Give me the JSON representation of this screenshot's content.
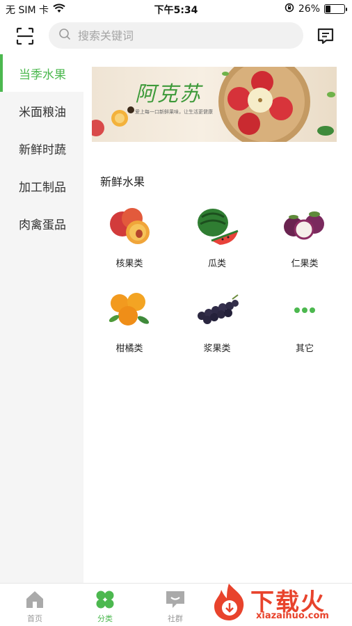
{
  "status_bar": {
    "carrier": "无 SIM 卡",
    "time": "下午5:34",
    "battery_percent": "26%",
    "battery_level": 0.26
  },
  "header": {
    "search_placeholder": "搜索关键词",
    "scan_icon": "scan-icon",
    "message_icon": "message-icon"
  },
  "sidebar": {
    "items": [
      {
        "label": "当季水果",
        "active": true
      },
      {
        "label": "米面粮油",
        "active": false
      },
      {
        "label": "新鲜时蔬",
        "active": false
      },
      {
        "label": "加工制品",
        "active": false
      },
      {
        "label": "肉禽蛋品",
        "active": false
      }
    ]
  },
  "banner": {
    "title": "阿克苏",
    "subtitle": "爱上每一口新鲜果味，让生活更健康"
  },
  "section": {
    "title": "新鲜水果",
    "categories": [
      {
        "label": "核果类",
        "icon": "peach-icon"
      },
      {
        "label": "瓜类",
        "icon": "watermelon-icon"
      },
      {
        "label": "仁果类",
        "icon": "mangosteen-icon"
      },
      {
        "label": "柑橘类",
        "icon": "orange-icon"
      },
      {
        "label": "浆果类",
        "icon": "grapes-icon"
      },
      {
        "label": "其它",
        "icon": "more-icon"
      }
    ]
  },
  "tabbar": {
    "tabs": [
      {
        "label": "首页",
        "icon": "home-icon"
      },
      {
        "label": "分类",
        "icon": "category-icon",
        "active": true
      },
      {
        "label": "社群",
        "icon": "chat-icon"
      }
    ]
  },
  "watermark": {
    "text": "下载火",
    "url": "xiazaihuo.com"
  },
  "colors": {
    "accent": "#4cb84f",
    "watermark": "#e8432c"
  }
}
